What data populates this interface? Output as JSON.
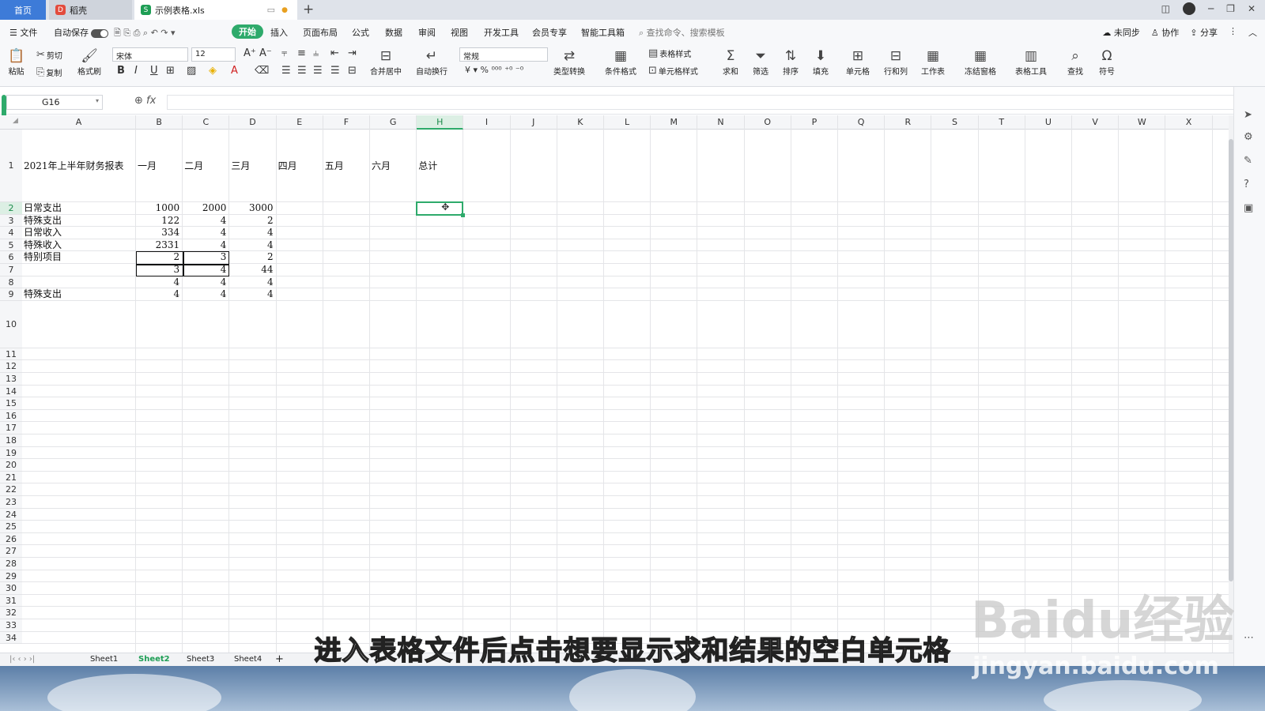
{
  "titlebar": {
    "tabs": [
      {
        "label": "首页"
      },
      {
        "label": "稻壳"
      },
      {
        "label": "示例表格.xls"
      }
    ],
    "new_tab": "+"
  },
  "menu": {
    "file": "文件",
    "autosave": "自动保存",
    "items": [
      "开始",
      "插入",
      "页面布局",
      "公式",
      "数据",
      "审阅",
      "视图",
      "开发工具",
      "会员专享",
      "智能工具箱"
    ],
    "active": "开始",
    "search_placeholder": "查找命令、搜索模板",
    "right": [
      "未同步",
      "协作",
      "分享"
    ]
  },
  "ribbon": {
    "paste": "粘贴",
    "cut": "剪切",
    "copy": "复制",
    "format_painter": "格式刷",
    "font": "宋体",
    "size": "12",
    "number_format": "常规",
    "merge": "合并居中",
    "wrap": "自动换行",
    "type_convert": "类型转换",
    "cond_format": "条件格式",
    "table_style": "表格样式",
    "cell_style": "单元格样式",
    "sum": "求和",
    "filter": "筛选",
    "sort": "排序",
    "fill": "填充",
    "cell": "单元格",
    "rowcol": "行和列",
    "sheet": "工作表",
    "freeze": "冻结窗格",
    "table_tools": "表格工具",
    "find": "查找",
    "symbol": "符号"
  },
  "formula_bar": {
    "name_box": "G16",
    "fx": "fx",
    "value": ""
  },
  "columns": [
    "A",
    "B",
    "C",
    "D",
    "E",
    "F",
    "G",
    "H",
    "I",
    "J",
    "K",
    "L",
    "M",
    "N",
    "O",
    "P",
    "Q",
    "R",
    "S",
    "T",
    "U",
    "V",
    "W",
    "X"
  ],
  "selected_column": "H",
  "selected_row": 2,
  "rows": [
    "1",
    "2",
    "3",
    "4",
    "5",
    "6",
    "7",
    "8",
    "9",
    "10",
    "11",
    "12",
    "13",
    "14",
    "15",
    "16",
    "17",
    "18",
    "19",
    "20",
    "21",
    "22",
    "23",
    "24",
    "25",
    "26",
    "27",
    "28",
    "29",
    "30",
    "31",
    "32",
    "33",
    "34"
  ],
  "cells": {
    "A1": "2021年上半年财务报表",
    "B1": "一月",
    "C1": "二月",
    "D1": "三月",
    "E1": "四月",
    "F1": "五月",
    "G1": "六月",
    "H1": "总计",
    "A2": "日常支出",
    "B2": "1000",
    "C2": "2000",
    "D2": "3000",
    "A3": "特殊支出",
    "B3": "122",
    "C3": "4",
    "D3": "2",
    "A4": "日常收入",
    "B4": "334",
    "C4": "4",
    "D4": "4",
    "A5": "特殊收入",
    "B5": "2331",
    "C5": "4",
    "D5": "4",
    "A6": "特别项目",
    "B6": "2",
    "C6": "3",
    "D6": "2",
    "B7": "3",
    "C7": "4",
    "D7": "44",
    "B8": "4",
    "C8": "4",
    "D8": "4",
    "A9": "特殊支出",
    "B9": "4",
    "C9": "4",
    "D9": "4"
  },
  "sheets": [
    "Sheet1",
    "Sheet2",
    "Sheet3",
    "Sheet4"
  ],
  "active_sheet": "Sheet2",
  "subtitle": "进入表格文件后点击想要显示求和结果的空白单元格",
  "watermark": {
    "brand": "Baidu经验",
    "url": "jingyan.baidu.com"
  }
}
